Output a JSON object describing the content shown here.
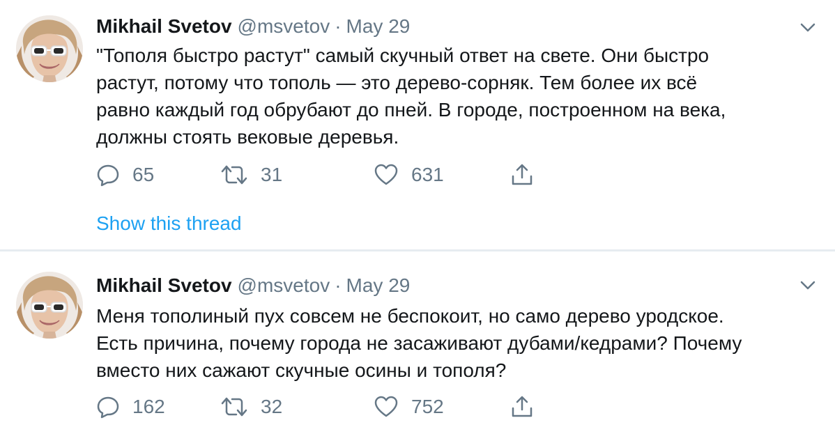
{
  "tweets": [
    {
      "author_name": "Mikhail Svetov",
      "handle": "@msvetov",
      "separator": "·",
      "date": "May 29",
      "text_lines": [
        "\"Тополя быстро растут\" самый скучный ответ на свете. Они быстро",
        "растут, потому что тополь — это дерево-сорняк. Тем более их всё",
        "равно каждый год обрубают до пней. В городе, построенном на века,",
        "должны стоять вековые деревья."
      ],
      "replies": "65",
      "retweets": "31",
      "likes": "631",
      "show_thread": "Show this thread"
    },
    {
      "author_name": "Mikhail Svetov",
      "handle": "@msvetov",
      "separator": "·",
      "date": "May 29",
      "text_lines": [
        "Меня тополиный пух совсем не беспокоит, но само дерево уродское.",
        "Есть причина, почему города не засаживают дубами/кедрами? Почему",
        "вместо них сажают скучные осины и тополя?"
      ],
      "replies": "162",
      "retweets": "32",
      "likes": "752"
    }
  ],
  "icons": {
    "reply": "reply-icon",
    "retweet": "retweet-icon",
    "like": "like-icon",
    "share": "share-icon",
    "caret": "chevron-down-icon"
  },
  "colors": {
    "link": "#1da1f2",
    "secondary": "#657786",
    "text": "#14171a",
    "divider": "#e6ecf0"
  }
}
